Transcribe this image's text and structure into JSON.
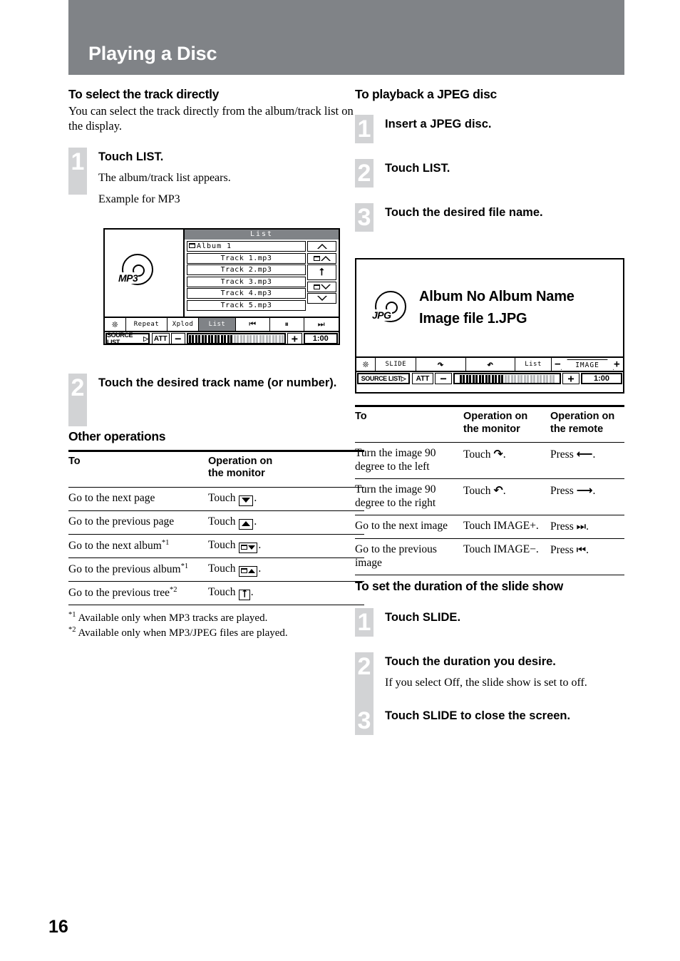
{
  "page": {
    "banner_title": "Playing a Disc",
    "page_number": "16",
    "banner_color": "#808387",
    "step_number_color": "#d2d3d5"
  },
  "left_column": {
    "section1": {
      "heading": "To select the track directly",
      "intro": "You can select the track directly from the album/track list on the display.",
      "steps": [
        {
          "num": "1",
          "title": "Touch LIST.",
          "body1": "The album/track list appears.",
          "body2": "Example for MP3"
        },
        {
          "num": "2",
          "title": "Touch the desired track name (or number)."
        }
      ]
    },
    "mp3_screen": {
      "disc_label": "MP3",
      "list_header": "List",
      "rows": [
        "Album  1",
        "Track 1.mp3",
        "Track 2.mp3",
        "Track 3.mp3",
        "Track 4.mp3",
        "Track 5.mp3"
      ],
      "side_buttons": [
        "page-up-icon",
        "folder-up-icon",
        "return-tree-icon",
        "folder-down-icon",
        "page-down-icon"
      ],
      "controls": {
        "star": "star-icon",
        "repeat": "Repeat",
        "xplod": "Xplod",
        "list": "List",
        "prev": "prev-track-icon",
        "pause": "pause-icon",
        "next": "next-track-icon"
      },
      "bottom": {
        "source_list": "SOURCE LIST",
        "att": "ATT",
        "minus": "−",
        "plus": "+",
        "time": "1:00",
        "volume_filled": 14,
        "volume_total": 30
      }
    },
    "other_operations": {
      "heading": "Other operations",
      "columns": [
        "To",
        "Operation on\nthe monitor"
      ],
      "col1_header": "To",
      "col2_header_line1": "Operation on",
      "col2_header_line2": "the monitor",
      "rows": [
        {
          "to": "Go to the next page",
          "to_sup": "",
          "op_prefix": "Touch",
          "op_icon": "page-down-icon"
        },
        {
          "to": "Go to the previous page",
          "to_sup": "",
          "op_prefix": "Touch",
          "op_icon": "page-up-icon"
        },
        {
          "to": "Go to the next album",
          "to_sup": "*1",
          "op_prefix": "Touch",
          "op_icon": "folder-down-icon"
        },
        {
          "to": "Go to the previous album",
          "to_sup": "*1",
          "op_prefix": "Touch",
          "op_icon": "folder-up-icon"
        },
        {
          "to": "Go to the previous tree",
          "to_sup": "*2",
          "op_prefix": "Touch",
          "op_icon": "return-tree-icon"
        }
      ],
      "footnotes": [
        {
          "marker": "*1",
          "text": "Available only when MP3 tracks are played."
        },
        {
          "marker": "*2",
          "text": "Available only when MP3/JPEG files are played."
        }
      ]
    }
  },
  "right_column": {
    "section1": {
      "heading": "To playback a JPEG disc",
      "steps": [
        {
          "num": "1",
          "title": "Insert a JPEG disc."
        },
        {
          "num": "2",
          "title": "Touch LIST."
        },
        {
          "num": "3",
          "title": "Touch the desired file name."
        }
      ]
    },
    "jpeg_screen": {
      "disc_label": "JPG",
      "line1": "Album No Album Name",
      "line2": "Image file 1.JPG",
      "controls": {
        "star": "star-icon",
        "slide": "SLIDE",
        "rotate_left": "rotate-left-icon",
        "rotate_right": "rotate-right-icon",
        "list": "List",
        "image_minus": "−",
        "image_label": "IMAGE",
        "image_plus": "+"
      },
      "bottom": {
        "source_list": "SOURCE LIST",
        "att": "ATT",
        "minus": "−",
        "plus": "+",
        "time": "1:00",
        "volume_filled": 14,
        "volume_total": 30
      }
    },
    "operations_table": {
      "col1_header": "To",
      "col2_header_line1": "Operation on",
      "col2_header_line2": "the monitor",
      "col3_header_line1": "Operation on",
      "col3_header_line2": "the remote",
      "rows": [
        {
          "to": "Turn the image 90 degree to the left",
          "monitor_prefix": "Touch",
          "monitor_icon": "rotate-left-icon",
          "monitor_suffix": ".",
          "remote_prefix": "Press",
          "remote_icon": "arrow-left-icon",
          "remote_suffix": "."
        },
        {
          "to": "Turn the image 90 degree to the right",
          "monitor_prefix": "Touch",
          "monitor_icon": "rotate-right-icon",
          "monitor_suffix": ".",
          "remote_prefix": "Press",
          "remote_icon": "arrow-right-icon",
          "remote_suffix": "."
        },
        {
          "to": "Go to the next image",
          "monitor_prefix": "Touch IMAGE+.",
          "monitor_icon": "",
          "monitor_suffix": "",
          "remote_prefix": "Press",
          "remote_icon": "next-track-icon",
          "remote_suffix": "."
        },
        {
          "to": "Go to the previous image",
          "monitor_prefix": "Touch IMAGE−.",
          "monitor_icon": "",
          "monitor_suffix": "",
          "remote_prefix": "Press",
          "remote_icon": "prev-track-icon",
          "remote_suffix": "."
        }
      ]
    },
    "section2": {
      "heading": "To set the duration of the slide show",
      "steps": [
        {
          "num": "1",
          "title": "Touch SLIDE."
        },
        {
          "num": "2",
          "title": "Touch the duration you desire.",
          "body": "If you select Off, the slide show is set to off."
        },
        {
          "num": "3",
          "title": "Touch SLIDE to close the screen."
        }
      ]
    }
  }
}
